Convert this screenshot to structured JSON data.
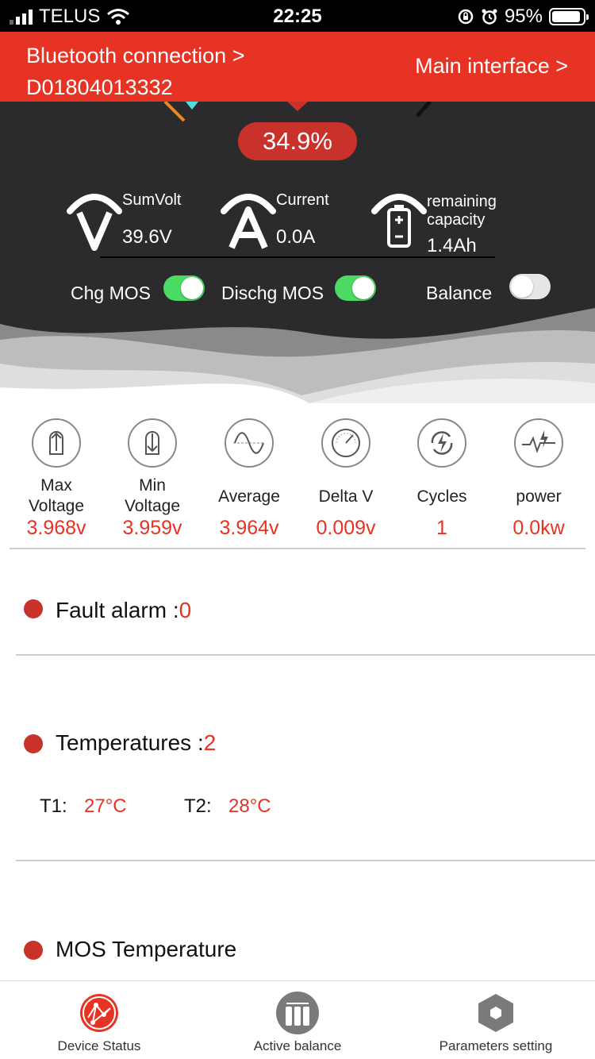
{
  "status_bar": {
    "carrier": "TELUS",
    "time": "22:25",
    "battery_pct": "95%"
  },
  "header": {
    "bluetooth_label": "Bluetooth connection >",
    "device_id": "D01804013332",
    "main_interface": "Main interface >"
  },
  "gauge": {
    "percent": "34.9%"
  },
  "metrics": {
    "sumvolt_label": "SumVolt",
    "sumvolt_value": "39.6V",
    "current_label": "Current",
    "current_value": "0.0A",
    "capacity_label_1": "remaining",
    "capacity_label_2": "capacity",
    "capacity_value": "1.4Ah"
  },
  "toggles": {
    "chg_label": "Chg MOS",
    "dischg_label": "Dischg MOS",
    "balance_label": "Balance",
    "chg_on": true,
    "dischg_on": true,
    "balance_on": false
  },
  "stats": [
    {
      "label1": "Max",
      "label2": "Voltage",
      "value": "3.968v",
      "icon": "arrow-up-icon"
    },
    {
      "label1": "Min",
      "label2": "Voltage",
      "value": "3.959v",
      "icon": "arrow-down-icon"
    },
    {
      "label1": "Average",
      "label2": "",
      "value": "3.964v",
      "icon": "sine-wave-icon"
    },
    {
      "label1": "Delta V",
      "label2": "",
      "value": "0.009v",
      "icon": "gauge-icon"
    },
    {
      "label1": "Cycles",
      "label2": "",
      "value": "1",
      "icon": "cycle-bolt-icon"
    },
    {
      "label1": "power",
      "label2": "",
      "value": "0.0kw",
      "icon": "pulse-bolt-icon"
    }
  ],
  "fault": {
    "title": "Fault alarm :",
    "count": "0"
  },
  "temperatures": {
    "title": "Temperatures :",
    "count": "2",
    "t1_label": "T1:",
    "t1_value": "27°C",
    "t2_label": "T2:",
    "t2_value": "28°C"
  },
  "mos_temperature": {
    "title": "MOS Temperature"
  },
  "tabs": [
    {
      "label": "Device Status",
      "active": true
    },
    {
      "label": "Active balance",
      "active": false
    },
    {
      "label": "Parameters setting",
      "active": false
    }
  ],
  "colors": {
    "accent_red": "#e63323",
    "dark_panel": "#2b2b2d",
    "toggle_on": "#4cd964"
  }
}
